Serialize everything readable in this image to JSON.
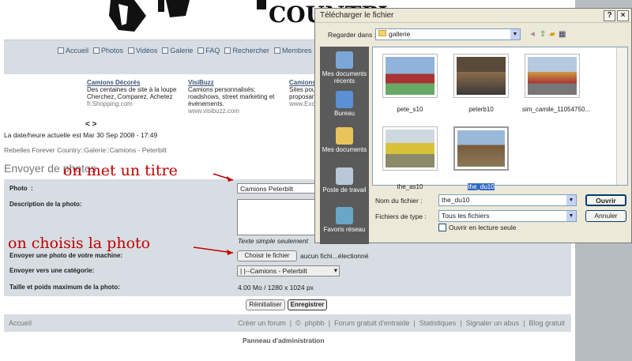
{
  "banner": {
    "text": "COUNTRY"
  },
  "nav": [
    "Accueil",
    "Photos",
    "Vidéos",
    "Galerie",
    "FAQ",
    "Rechercher",
    "Membres"
  ],
  "ads": [
    {
      "title": "Camions Décorés",
      "lines": [
        "Des centaines de site à la loupe",
        "Cherchez, Comparez, Achetez"
      ],
      "url": "fr.Shopping.com"
    },
    {
      "title": "VisiBuzz",
      "lines": [
        "Camions personnalisés:",
        "roadshows, street marketing et",
        "événements."
      ],
      "url": "www.visibuzz.com"
    },
    {
      "title": "Camions",
      "lines": [
        "Sites pou",
        "proposant"
      ],
      "url": "www.Excit"
    }
  ],
  "pager": "< >",
  "date": "La date/heure actuelle est Mar 30 Sep 2008 - 17:49",
  "breadcrumb": "Rebelles Forever Country::Galerie::Camions - Peterbilt",
  "page_title": "Envoyer de photos",
  "form": {
    "photo_label": "Photo",
    "photo_value": "Camions Peterbilt",
    "desc_label": "Description de la photo:",
    "hint": "Texte simple seulement",
    "upload_label": "Envoyer une photo de votre machine:",
    "choose_btn": "Choisir le fichier",
    "no_file": "aucun fichi...électionné",
    "cat_label": "Envoyer vers une catégorie:",
    "cat_value": "|   |--Camions - Peterbilt",
    "size_label": "Taille et poids maximum de la photo:",
    "size_value": "4.00 Mo / 1280 x 1024 px",
    "reset_btn": "Réinitialiser",
    "save_btn": "Enregistrer"
  },
  "footer": {
    "left": "Accueil",
    "links": [
      "Créer un forum",
      "|",
      "©",
      "phpbb",
      "|",
      "Forum gratuit d'entraide",
      "|",
      "Statistiques",
      "|",
      "Signaler un abus",
      "|",
      "Blog gratuit"
    ]
  },
  "admin": "Panneau d'administration",
  "annotations": {
    "title": "on met un titre",
    "photo": "on choisis la photo"
  },
  "dialog": {
    "title": "Télécharger le fichier",
    "lookin_label": "Regarder dans :",
    "lookin_value": "gallerie",
    "places": [
      "Mes documents récents",
      "Bureau",
      "Mes documents",
      "Poste de travail",
      "Favoris réseau"
    ],
    "files": [
      "pete_s10",
      "peterb10",
      "sim_camile_11054750...",
      "the_as10",
      "the_du10"
    ],
    "filename_label": "Nom du fichier :",
    "filename_value": "the_du10",
    "type_label": "Fichiers de type :",
    "type_value": "Tous les fichiers",
    "readonly_label": "Ouvrir en lecture seule",
    "open_btn": "Ouvrir",
    "cancel_btn": "Annuler"
  }
}
